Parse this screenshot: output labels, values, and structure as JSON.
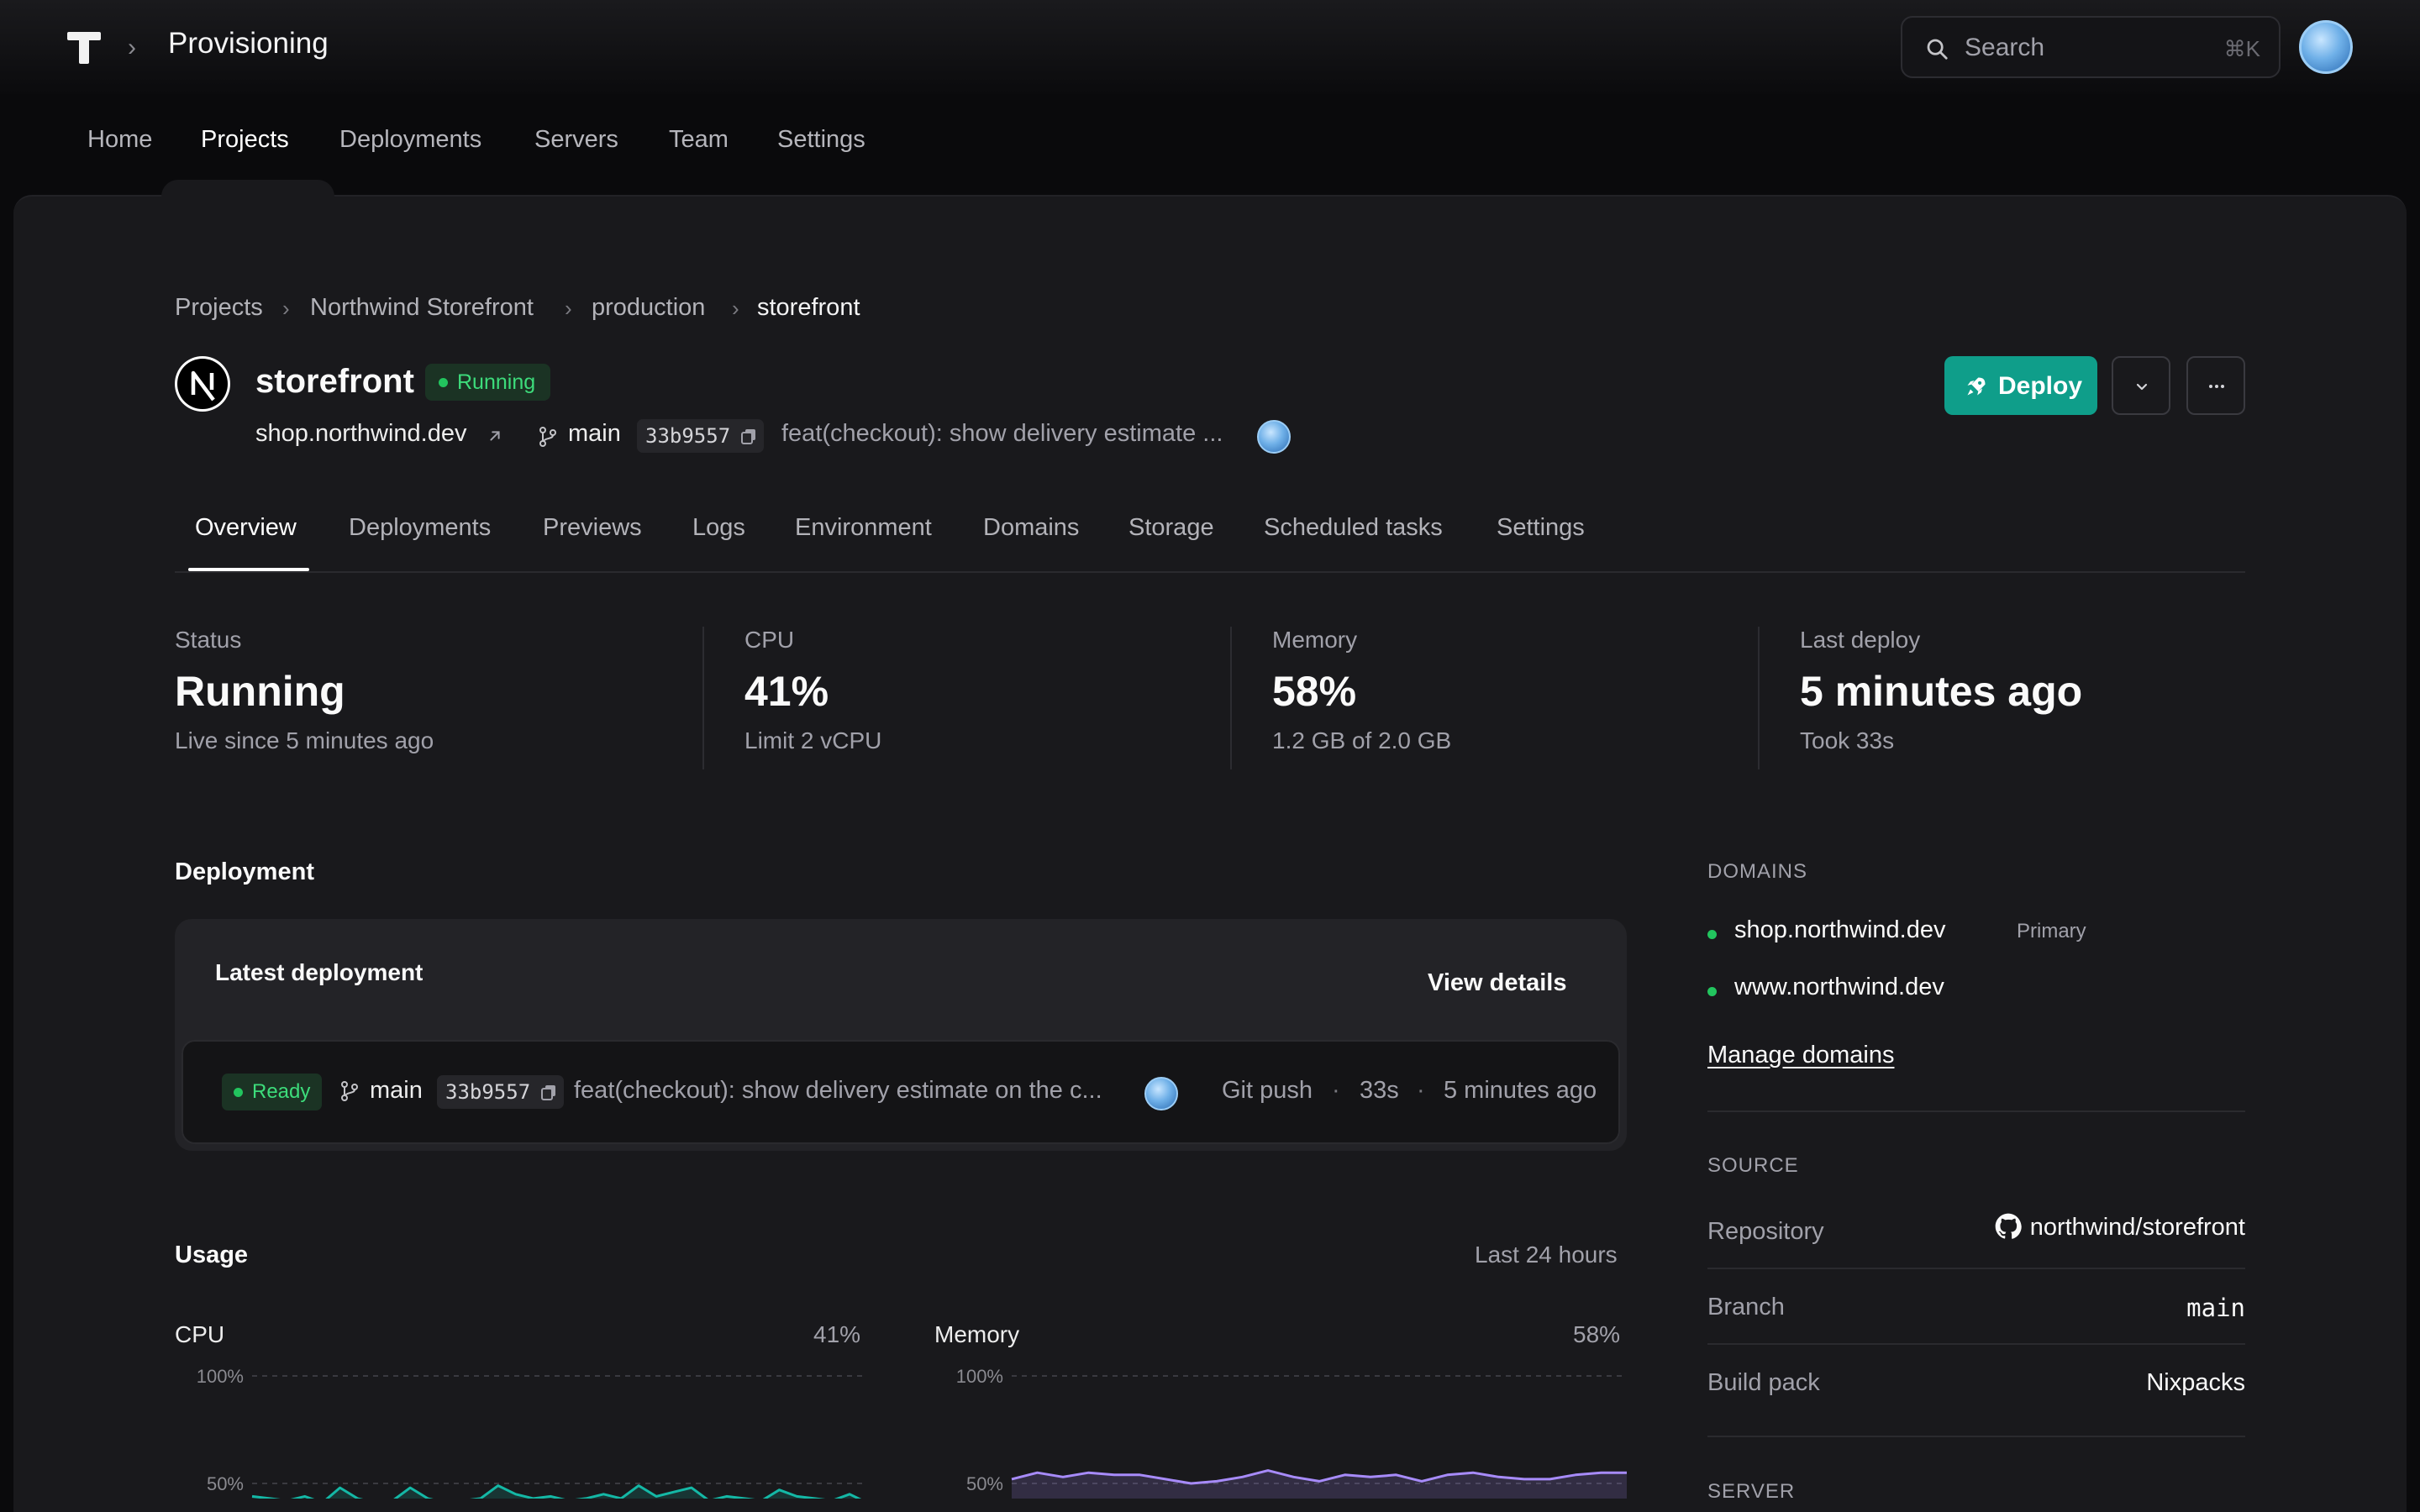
{
  "header": {
    "app_title": "Provisioning",
    "search_placeholder": "Search",
    "search_shortcut": "⌘K"
  },
  "main_nav": [
    "Home",
    "Projects",
    "Deployments",
    "Servers",
    "Team",
    "Settings"
  ],
  "main_nav_active": "Projects",
  "breadcrumb": [
    "Projects",
    "Northwind Storefront",
    "production",
    "storefront"
  ],
  "project": {
    "name": "storefront",
    "status": "Running",
    "domain": "shop.northwind.dev",
    "branch": "main",
    "commit_sha": "33b9557",
    "commit_message": "feat(checkout): show delivery estimate ...",
    "deploy_label": "Deploy"
  },
  "tabs": [
    "Overview",
    "Deployments",
    "Previews",
    "Logs",
    "Environment",
    "Domains",
    "Storage",
    "Scheduled tasks",
    "Settings"
  ],
  "tabs_active": "Overview",
  "stats": [
    {
      "label": "Status",
      "value": "Running",
      "sub": "Live since 5 minutes ago"
    },
    {
      "label": "CPU",
      "value": "41%",
      "sub": "Limit 2 vCPU"
    },
    {
      "label": "Memory",
      "value": "58%",
      "sub": "1.2 GB of 2.0 GB"
    },
    {
      "label": "Last deploy",
      "value": "5 minutes ago",
      "sub": "Took 33s"
    }
  ],
  "deployment": {
    "section_title": "Deployment",
    "card_title": "Latest deployment",
    "view_details": "View details",
    "status": "Ready",
    "branch": "main",
    "commit_sha": "33b9557",
    "commit_message": "feat(checkout): show delivery estimate on the c...",
    "trigger": "Git push",
    "dot": "·",
    "duration": "33s",
    "time": "5 minutes ago"
  },
  "usage": {
    "section_title": "Usage",
    "range": "Last 24 hours",
    "cpu": {
      "title": "CPU",
      "current": "41%",
      "tick_labels": [
        "100%",
        "50%"
      ],
      "color": "#14b8a6"
    },
    "memory": {
      "title": "Memory",
      "current": "58%",
      "tick_labels": [
        "100%",
        "50%"
      ],
      "color": "#a78bfa"
    }
  },
  "chart_data": [
    {
      "type": "area",
      "title": "CPU",
      "ylim": [
        0,
        100
      ],
      "y_ticks": [
        "100%",
        "50%"
      ],
      "values": [
        44,
        43,
        42,
        44,
        41,
        48,
        43,
        41,
        42,
        48,
        43,
        41,
        42,
        43,
        49,
        45,
        43,
        44,
        42,
        43,
        45,
        43,
        49,
        44,
        46,
        48,
        42,
        44,
        43,
        42,
        47,
        44,
        43,
        42,
        45,
        41
      ]
    },
    {
      "type": "area",
      "title": "Memory",
      "ylim": [
        0,
        100
      ],
      "y_ticks": [
        "100%",
        "50%"
      ],
      "values": [
        52,
        55,
        53,
        55,
        54,
        54,
        52,
        50,
        51,
        53,
        56,
        53,
        51,
        54,
        53,
        54,
        51,
        54,
        55,
        53,
        52,
        52,
        54,
        55,
        55
      ]
    }
  ],
  "side": {
    "domains_header": "DOMAINS",
    "domains": [
      {
        "name": "shop.northwind.dev",
        "tag": "Primary"
      },
      {
        "name": "www.northwind.dev",
        "tag": ""
      }
    ],
    "manage_domains": "Manage domains",
    "source_header": "SOURCE",
    "source": [
      {
        "key": "Repository",
        "value": "northwind/storefront"
      },
      {
        "key": "Branch",
        "value": "main"
      },
      {
        "key": "Build pack",
        "value": "Nixpacks"
      }
    ],
    "server_header": "SERVER"
  }
}
